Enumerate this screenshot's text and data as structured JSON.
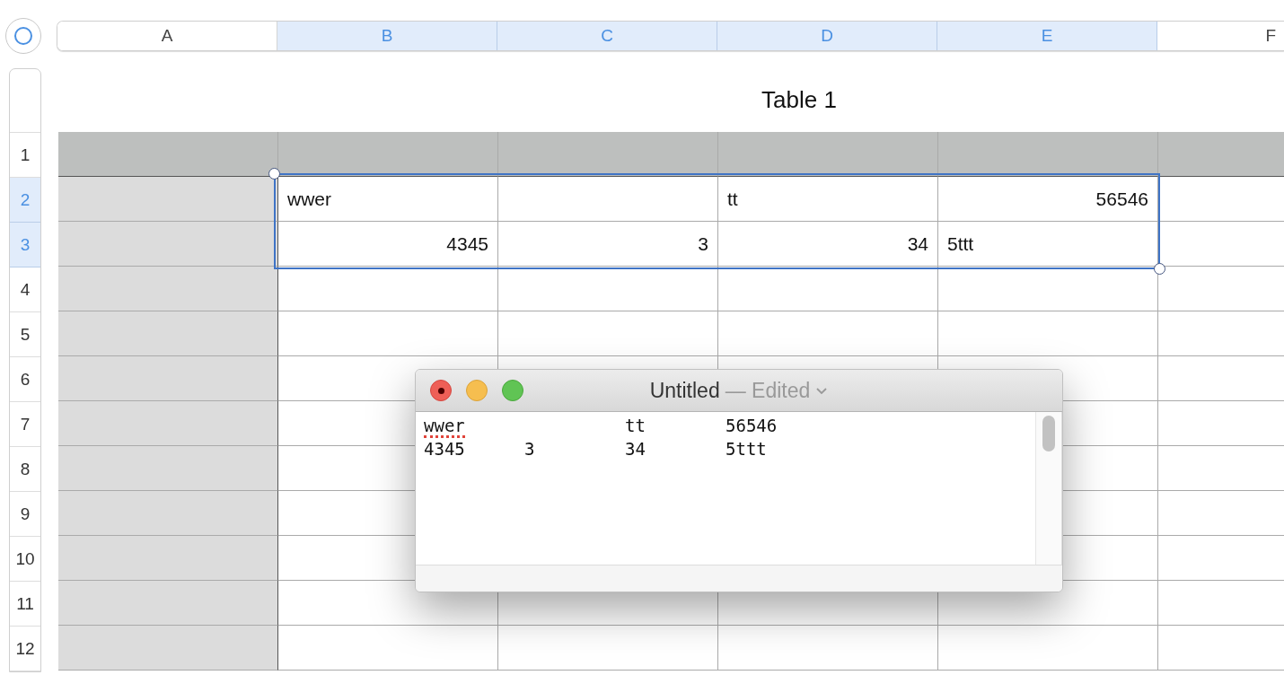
{
  "column_headers": [
    {
      "label": "A",
      "selected": false
    },
    {
      "label": "B",
      "selected": true
    },
    {
      "label": "C",
      "selected": true
    },
    {
      "label": "D",
      "selected": true
    },
    {
      "label": "E",
      "selected": true
    },
    {
      "label": "F",
      "selected": false
    }
  ],
  "row_headers": [
    {
      "label": "1",
      "selected": false
    },
    {
      "label": "2",
      "selected": true
    },
    {
      "label": "3",
      "selected": true
    },
    {
      "label": "4",
      "selected": false
    },
    {
      "label": "5",
      "selected": false
    },
    {
      "label": "6",
      "selected": false
    },
    {
      "label": "7",
      "selected": false
    },
    {
      "label": "8",
      "selected": false
    },
    {
      "label": "9",
      "selected": false
    },
    {
      "label": "10",
      "selected": false
    },
    {
      "label": "11",
      "selected": false
    },
    {
      "label": "12",
      "selected": false
    }
  ],
  "table": {
    "title": "Table 1",
    "rows": [
      [
        null,
        null,
        null,
        null,
        null,
        null
      ],
      [
        null,
        {
          "text": "wwer",
          "kind": "text"
        },
        null,
        {
          "text": "tt",
          "kind": "text"
        },
        {
          "text": "56546",
          "kind": "number"
        },
        null
      ],
      [
        null,
        {
          "text": "4345",
          "kind": "number"
        },
        {
          "text": "3",
          "kind": "number"
        },
        {
          "text": "34",
          "kind": "number"
        },
        {
          "text": "5ttt",
          "kind": "text"
        },
        null
      ],
      [
        null,
        null,
        null,
        null,
        null,
        null
      ],
      [
        null,
        null,
        null,
        null,
        null,
        null
      ],
      [
        null,
        null,
        null,
        null,
        null,
        null
      ],
      [
        null,
        null,
        null,
        null,
        null,
        null
      ],
      [
        null,
        null,
        null,
        null,
        null,
        null
      ],
      [
        null,
        null,
        null,
        null,
        null,
        null
      ],
      [
        null,
        null,
        null,
        null,
        null,
        null
      ],
      [
        null,
        null,
        null,
        null,
        null,
        null
      ],
      [
        null,
        null,
        null,
        null,
        null,
        null
      ]
    ]
  },
  "text_editor": {
    "title": "Untitled",
    "status": "— Edited",
    "lines": [
      [
        {
          "text": "wwer",
          "misspelled": true
        },
        {
          "text": "\t\ttt\t56546",
          "misspelled": false
        }
      ],
      [
        {
          "text": "4345\t3\t34\t5ttt",
          "misspelled": false
        }
      ]
    ]
  }
}
